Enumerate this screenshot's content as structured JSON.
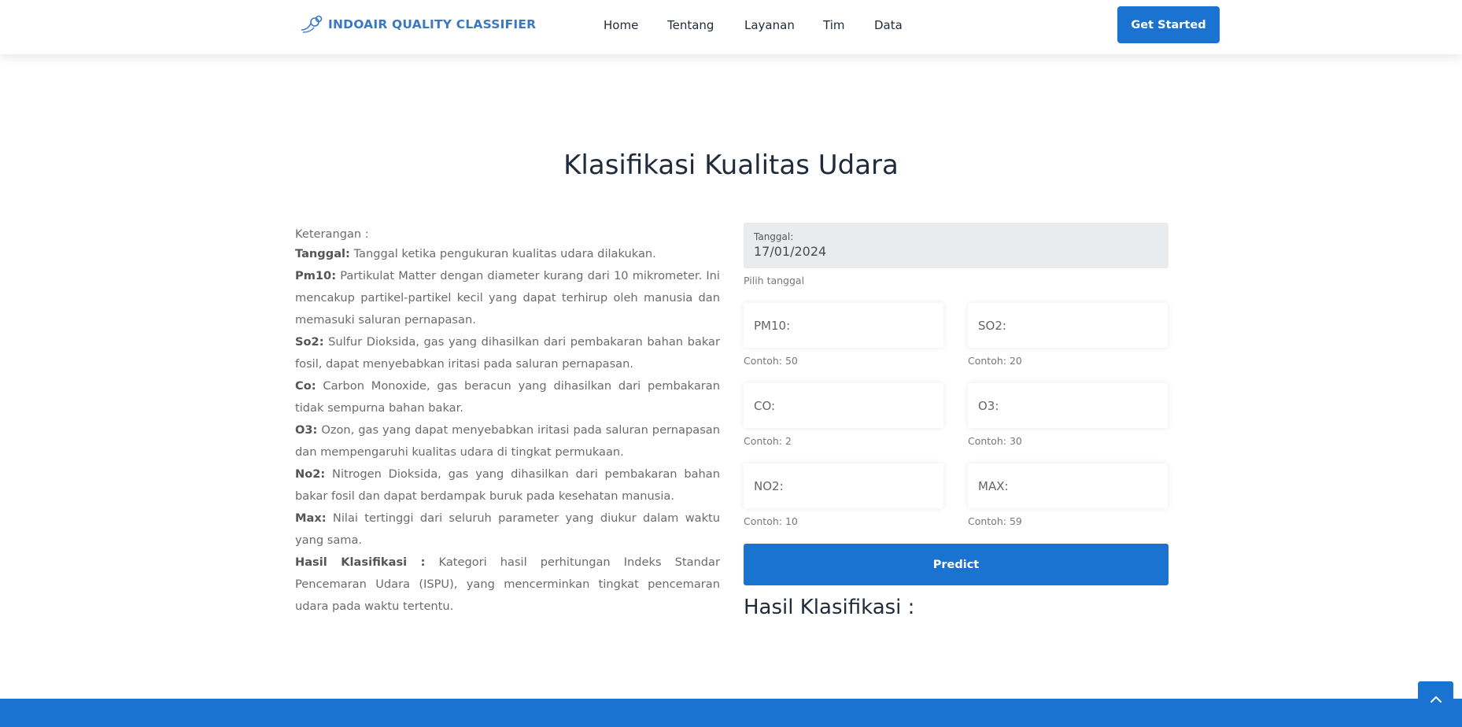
{
  "brand": {
    "name": "INDOAIR QUALITY CLASSIFIER",
    "color": "#3a78c4"
  },
  "nav": {
    "items": [
      "Home",
      "Tentang",
      "Layanan",
      "Tim",
      "Data"
    ],
    "cta": "Get Started"
  },
  "accent_color": "#1a73d0",
  "page_title": "Klasifikasi Kualitas Udara",
  "description": {
    "heading": "Keterangan :",
    "items": [
      {
        "term": "Tanggal:",
        "text": " Tanggal ketika pengukuran kualitas udara dilakukan."
      },
      {
        "term": "Pm10:",
        "text": " Partikulat Matter dengan diameter kurang dari 10 mikrometer. Ini mencakup partikel-partikel kecil yang dapat terhirup oleh manusia dan memasuki saluran pernapasan."
      },
      {
        "term": "So2:",
        "text": " Sulfur Dioksida, gas yang dihasilkan dari pembakaran bahan bakar fosil, dapat menyebabkan iritasi pada saluran pernapasan."
      },
      {
        "term": "Co:",
        "text": " Carbon Monoxide, gas beracun yang dihasilkan dari pembakaran tidak sempurna bahan bakar."
      },
      {
        "term": "O3:",
        "text": " Ozon, gas yang dapat menyebabkan iritasi pada saluran pernapasan dan mempengaruhi kualitas udara di tingkat permukaan."
      },
      {
        "term": "No2:",
        "text": " Nitrogen Dioksida, gas yang dihasilkan dari pembakaran bahan bakar fosil dan dapat berdampak buruk pada kesehatan manusia."
      },
      {
        "term": "Max:",
        "text": " Nilai tertinggi dari seluruh parameter yang diukur dalam waktu yang sama."
      },
      {
        "term": "Hasil Klasifikasi :",
        "text": " Kategori hasil perhitungan Indeks Standar Pencemaran Udara (ISPU), yang mencerminkan tingkat pencemaran udara pada waktu tertentu."
      }
    ]
  },
  "form": {
    "date": {
      "label": "Tanggal:",
      "value": "17/01/2024",
      "hint": "Pilih tanggal"
    },
    "fields": [
      {
        "placeholder": "PM10:",
        "hint": "Contoh: 50"
      },
      {
        "placeholder": "SO2:",
        "hint": "Contoh: 20"
      },
      {
        "placeholder": "CO:",
        "hint": "Contoh: 2"
      },
      {
        "placeholder": "O3:",
        "hint": "Contoh: 30"
      },
      {
        "placeholder": "NO2:",
        "hint": "Contoh: 10"
      },
      {
        "placeholder": "MAX:",
        "hint": "Contoh: 59"
      }
    ],
    "submit_label": "Predict"
  },
  "result": {
    "title": "Hasil Klasifikasi :"
  },
  "back_to_top_icon": "chevron-up-icon"
}
